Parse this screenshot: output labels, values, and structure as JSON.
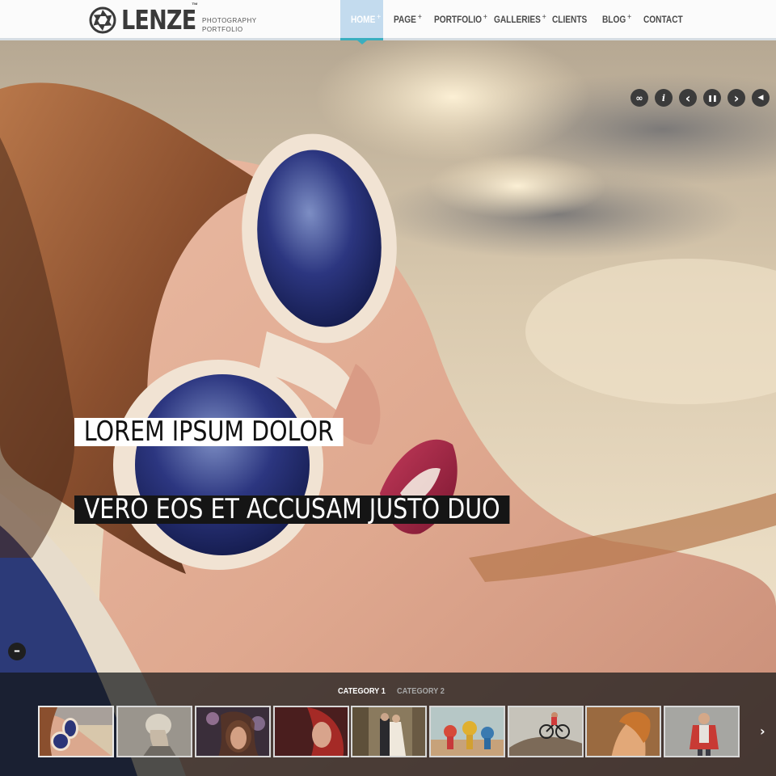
{
  "header": {
    "logo_text": "LENZE",
    "logo_tm": "™",
    "tagline_line1": "PHOTOGRAPHY",
    "tagline_line2": "PORTFOLIO",
    "nav": [
      {
        "label": "HOME",
        "has_sub": true,
        "active": true
      },
      {
        "label": "PAGE",
        "has_sub": true
      },
      {
        "label": "PORTFOLIO",
        "has_sub": true
      },
      {
        "label": "GALLERIES",
        "has_sub": true
      },
      {
        "label": "CLIENTS",
        "has_sub": false
      },
      {
        "label": "BLOG",
        "has_sub": true
      },
      {
        "label": "CONTACT",
        "has_sub": false
      }
    ],
    "sub_indicator": "+",
    "accent_color": "#3aaebf"
  },
  "slider": {
    "captions": [
      "LOREM IPSUM DOLOR",
      "VERO EOS ET ACCUSAM JUSTO DUO"
    ],
    "controls": [
      {
        "name": "link-icon",
        "glyph": "∞"
      },
      {
        "name": "info-icon",
        "glyph": "i"
      },
      {
        "name": "previous-icon",
        "glyph": "‹"
      },
      {
        "name": "pause-icon",
        "glyph": "❚❚"
      },
      {
        "name": "next-icon",
        "glyph": "›"
      },
      {
        "name": "volume-icon",
        "glyph": "◀"
      }
    ],
    "collapse_glyph": "–"
  },
  "thumbnails": {
    "categories": [
      {
        "label": "CATEGORY 1",
        "active": true
      },
      {
        "label": "CATEGORY 2",
        "active": false
      }
    ],
    "items_count_visible": 9,
    "next_glyph": "›"
  }
}
